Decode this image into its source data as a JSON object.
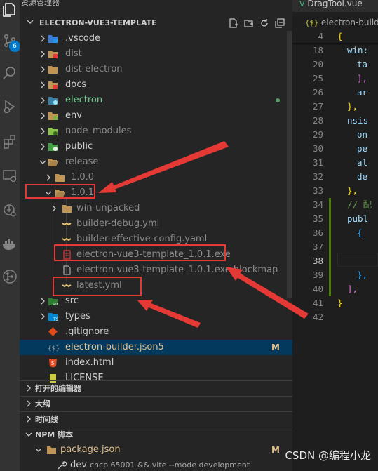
{
  "colors": {
    "accent": "#007acc",
    "annotation": "#e53935",
    "selection": "#04395e",
    "git_modified": "#e2c08d",
    "git_added": "#73c991"
  },
  "activity_bar": {
    "source_control_badge": "6"
  },
  "sidebar": {
    "title": "资源管理器",
    "more": "···",
    "project_title": "ELECTRON-VUE3-TEMPLATE",
    "tree": [
      {
        "label": ".vscode",
        "icon": "folder-vscode-icon"
      },
      {
        "label": "dist",
        "icon": "folder-dist-icon"
      },
      {
        "label": "dist-electron",
        "icon": "folder-icon"
      },
      {
        "label": "docs",
        "icon": "folder-docs-icon"
      },
      {
        "label": "electron",
        "icon": "folder-electron-icon",
        "decoration": "green-dot"
      },
      {
        "label": "env",
        "icon": "folder-env-icon"
      },
      {
        "label": "node_modules",
        "icon": "folder-node-icon"
      },
      {
        "label": "public",
        "icon": "folder-public-icon"
      },
      {
        "label": "release",
        "icon": "folder-open-icon"
      },
      {
        "label": "1.0.0",
        "icon": "folder-icon"
      },
      {
        "label": "1.0.1",
        "icon": "folder-open-icon"
      },
      {
        "label": "win-unpacked",
        "icon": "folder-icon"
      },
      {
        "label": "builder-debug.yml",
        "icon": "yaml-icon"
      },
      {
        "label": "builder-effective-config.yaml",
        "icon": "yaml-icon"
      },
      {
        "label": "electron-vue3-template_1.0.1.exe",
        "icon": "exe-icon"
      },
      {
        "label": "electron-vue3-template_1.0.1.exe.blockmap",
        "icon": "file-icon"
      },
      {
        "label": "latest.yml",
        "icon": "yaml-icon"
      },
      {
        "label": "src",
        "icon": "folder-src-icon"
      },
      {
        "label": "types",
        "icon": "folder-types-icon"
      },
      {
        "label": ".gitignore",
        "icon": "git-icon"
      },
      {
        "label": "electron-builder.json5",
        "icon": "json5-icon",
        "decoration": "M"
      },
      {
        "label": "index.html",
        "icon": "html-icon"
      },
      {
        "label": "LICENSE",
        "icon": "license-icon"
      }
    ],
    "panels": {
      "open_editors": "打开的编辑器",
      "outline": "大纲",
      "timeline": "时间线",
      "npm_scripts": "NPM 脚本",
      "npm_package": "package.json",
      "npm_package_decoration": "M",
      "npm_script_name": "dev",
      "npm_script_cmd": "chcp 65001 && vite --mode development"
    }
  },
  "editor": {
    "tab": "DragTool.vue",
    "breadcrumb_icon": "{$}",
    "breadcrumb": "electron-builde",
    "lines": [
      {
        "n": "4",
        "t": "{"
      },
      {
        "n": "18",
        "t": "win:"
      },
      {
        "n": "20",
        "t": "ta"
      },
      {
        "n": "25",
        "t": "],"
      },
      {
        "n": "26",
        "t": "ar"
      },
      {
        "n": "27",
        "t": "},"
      },
      {
        "n": "28",
        "t": "nsis"
      },
      {
        "n": "29",
        "t": "on"
      },
      {
        "n": "30",
        "t": "pe"
      },
      {
        "n": "31",
        "t": "al"
      },
      {
        "n": "32",
        "t": "de"
      },
      {
        "n": "33",
        "t": "},"
      },
      {
        "n": "34",
        "t": "// 配"
      },
      {
        "n": "35",
        "t": "publ"
      },
      {
        "n": "36",
        "t": "{"
      },
      {
        "n": "37",
        "t": ""
      },
      {
        "n": "38",
        "t": ""
      },
      {
        "n": "39",
        "t": "},"
      },
      {
        "n": "40",
        "t": "],"
      },
      {
        "n": "41",
        "t": "}"
      },
      {
        "n": "42",
        "t": ""
      }
    ]
  },
  "watermark": "CSDN @编程小龙"
}
